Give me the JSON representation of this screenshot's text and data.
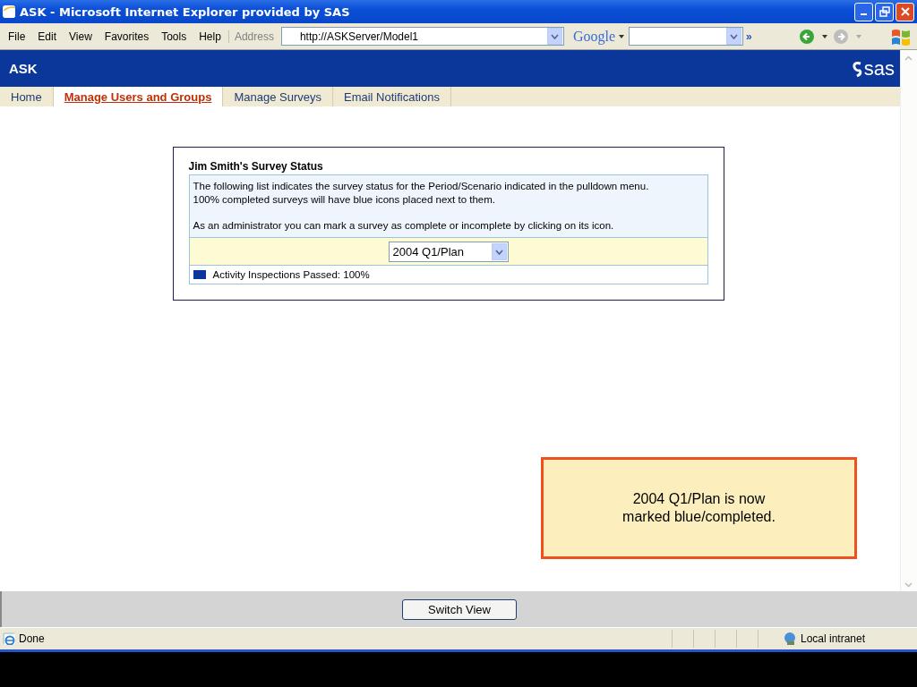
{
  "window": {
    "title": "ASK - Microsoft Internet Explorer provided by SAS"
  },
  "menu": [
    "File",
    "Edit",
    "View",
    "Favorites",
    "Tools",
    "Help"
  ],
  "address": {
    "label": "Address",
    "value": "http://ASKServer/Model1"
  },
  "google": {
    "label": "Google",
    "chevron": "»"
  },
  "app": {
    "title": "ASK",
    "logo": "sas"
  },
  "tabs": [
    {
      "label": "Home",
      "selected": false
    },
    {
      "label": "Manage Users and Groups",
      "selected": true
    },
    {
      "label": "Manage Surveys",
      "selected": false
    },
    {
      "label": "Email Notifications",
      "selected": false
    }
  ],
  "panel": {
    "title": "Jim Smith's Survey Status",
    "intro": [
      "The following list indicates the survey status for the Period/Scenario indicated in the pulldown menu.",
      "100% completed surveys will have blue icons placed next to them."
    ],
    "note": "As an administrator you can mark a survey as complete or incomplete by clicking on its icon.",
    "period": "2004 Q1/Plan",
    "surveys": [
      {
        "label": "Activity Inspections Passed: 100%",
        "completed": true
      }
    ]
  },
  "callout": [
    "2004 Q1/Plan is now",
    "marked blue/completed."
  ],
  "switch_button": "Switch View",
  "status_bar": {
    "status": "Done",
    "zone": "Local intranet"
  }
}
